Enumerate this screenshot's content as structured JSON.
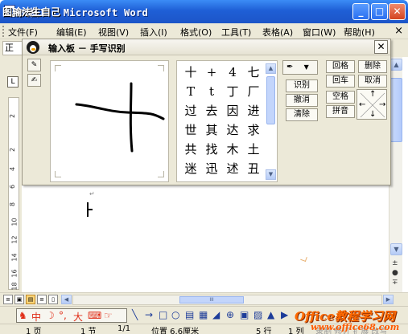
{
  "window": {
    "title": "文档1 - Microsoft Word",
    "overlay_text": "图输法生自己",
    "controls": {
      "minimize": "_",
      "maximize": "□",
      "close": "✕"
    }
  },
  "menubar": {
    "items": [
      "文件(F)",
      "编辑(E)",
      "视图(V)",
      "插入(I)",
      "格式(O)",
      "工具(T)",
      "表格(A)",
      "窗口(W)",
      "帮助(H)"
    ],
    "close": "×"
  },
  "toolbar": {
    "style_fragment": "正"
  },
  "ime_panel": {
    "title": "输入板 － 手写识别",
    "close": "✕",
    "side_icons": [
      "handwriting-tool-icon",
      "pen-icon"
    ],
    "candidates": [
      [
        "十",
        "+",
        "4",
        "七"
      ],
      [
        "T",
        "t",
        "丁",
        "厂"
      ],
      [
        "过",
        "去",
        "因",
        "进"
      ],
      [
        "世",
        "其",
        "达",
        "求"
      ],
      [
        "共",
        "找",
        "木",
        "土"
      ],
      [
        "迷",
        "迅",
        "述",
        "丑"
      ]
    ],
    "buttons_mid": [
      "识别",
      "撤消",
      "清除"
    ],
    "buttons_right": [
      [
        "回格",
        "删除"
      ],
      [
        "回车",
        "取消"
      ],
      [
        "空格"
      ],
      [
        "拼音"
      ]
    ],
    "pen_dropdown": "▼"
  },
  "document": {
    "paragraph_mark": "↵"
  },
  "vruler_numbers": [
    "2",
    "2",
    "4",
    "6",
    "8",
    "10",
    "12",
    "14",
    "16",
    "18"
  ],
  "hscroll": {
    "view_buttons": [
      "≡",
      "▣",
      "▤",
      "≡"
    ],
    "thumb": "III"
  },
  "drawbar": {
    "ime_items": [
      "中",
      "☽",
      "°,",
      "大",
      "⌨"
    ],
    "logo": "Office教程学习网",
    "tools": [
      "╲",
      "→",
      "□",
      "○",
      "▤",
      "▦",
      "◢",
      "⊕",
      "▣",
      "▨",
      "▲",
      "▶"
    ]
  },
  "statusbar": {
    "page": "1 页",
    "section": "1 节",
    "pages": "1/1",
    "position": "位置 6.6厘米",
    "line": "5 行",
    "column": "1 列",
    "modes": "录制 修订 扩展 改写",
    "url": "www.office68.com"
  }
}
